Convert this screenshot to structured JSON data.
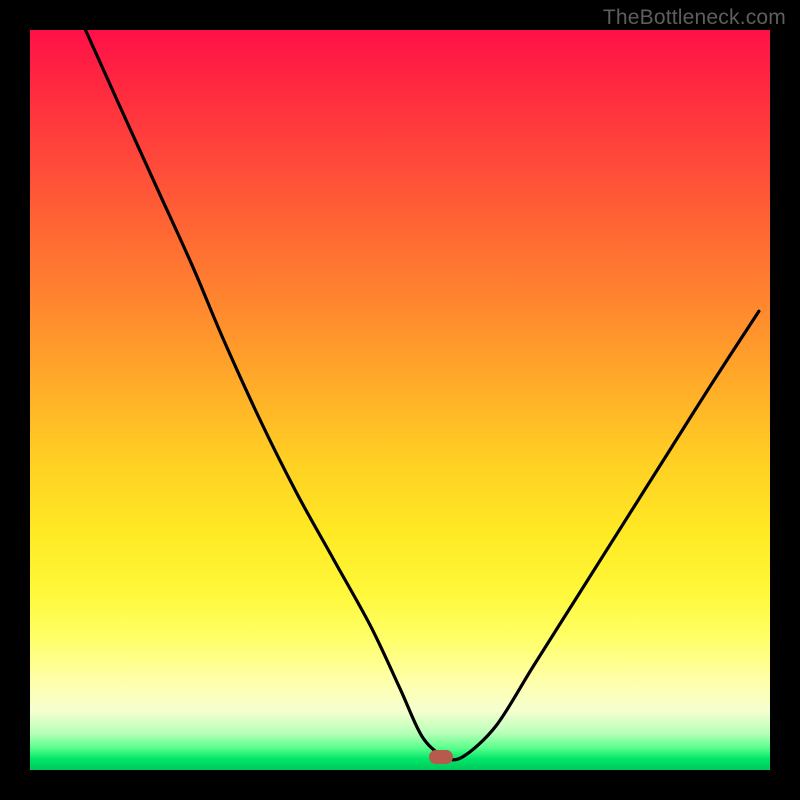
{
  "watermark": "TheBottleneck.com",
  "marker": {
    "color": "#b55a4c",
    "cx_frac": 0.555,
    "cy_frac": 0.983
  },
  "chart_data": {
    "type": "line",
    "title": "",
    "xlabel": "",
    "ylabel": "",
    "xlim": [
      0,
      1
    ],
    "ylim": [
      0,
      1
    ],
    "series": [
      {
        "name": "bottleneck-curve",
        "x": [
          0.075,
          0.12,
          0.17,
          0.22,
          0.26,
          0.31,
          0.36,
          0.41,
          0.46,
          0.5,
          0.53,
          0.56,
          0.585,
          0.63,
          0.68,
          0.74,
          0.8,
          0.86,
          0.92,
          0.985
        ],
        "y": [
          1.0,
          0.9,
          0.79,
          0.68,
          0.585,
          0.475,
          0.375,
          0.285,
          0.195,
          0.11,
          0.045,
          0.018,
          0.018,
          0.06,
          0.14,
          0.235,
          0.33,
          0.425,
          0.52,
          0.62
        ]
      }
    ],
    "annotations": [
      {
        "name": "optimal-marker",
        "x": 0.555,
        "y": 0.017
      }
    ],
    "background_gradient": {
      "top": "#ff1048",
      "mid": "#ffe924",
      "bottom": "#00c85a"
    }
  }
}
